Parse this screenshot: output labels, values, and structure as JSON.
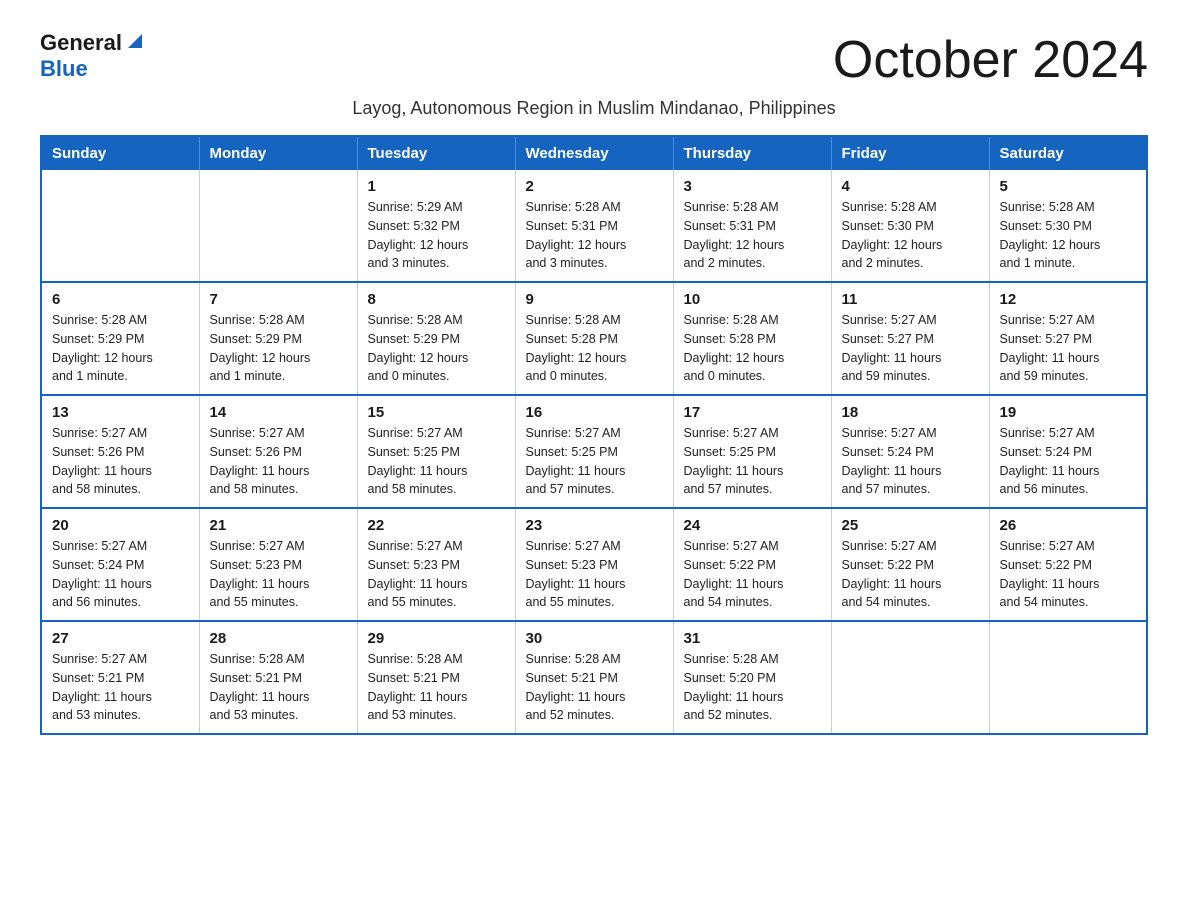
{
  "header": {
    "logo_general": "General",
    "logo_blue": "Blue",
    "month_title": "October 2024",
    "subtitle": "Layog, Autonomous Region in Muslim Mindanao, Philippines"
  },
  "weekdays": [
    "Sunday",
    "Monday",
    "Tuesday",
    "Wednesday",
    "Thursday",
    "Friday",
    "Saturday"
  ],
  "weeks": [
    [
      {
        "day": "",
        "info": ""
      },
      {
        "day": "",
        "info": ""
      },
      {
        "day": "1",
        "info": "Sunrise: 5:29 AM\nSunset: 5:32 PM\nDaylight: 12 hours\nand 3 minutes."
      },
      {
        "day": "2",
        "info": "Sunrise: 5:28 AM\nSunset: 5:31 PM\nDaylight: 12 hours\nand 3 minutes."
      },
      {
        "day": "3",
        "info": "Sunrise: 5:28 AM\nSunset: 5:31 PM\nDaylight: 12 hours\nand 2 minutes."
      },
      {
        "day": "4",
        "info": "Sunrise: 5:28 AM\nSunset: 5:30 PM\nDaylight: 12 hours\nand 2 minutes."
      },
      {
        "day": "5",
        "info": "Sunrise: 5:28 AM\nSunset: 5:30 PM\nDaylight: 12 hours\nand 1 minute."
      }
    ],
    [
      {
        "day": "6",
        "info": "Sunrise: 5:28 AM\nSunset: 5:29 PM\nDaylight: 12 hours\nand 1 minute."
      },
      {
        "day": "7",
        "info": "Sunrise: 5:28 AM\nSunset: 5:29 PM\nDaylight: 12 hours\nand 1 minute."
      },
      {
        "day": "8",
        "info": "Sunrise: 5:28 AM\nSunset: 5:29 PM\nDaylight: 12 hours\nand 0 minutes."
      },
      {
        "day": "9",
        "info": "Sunrise: 5:28 AM\nSunset: 5:28 PM\nDaylight: 12 hours\nand 0 minutes."
      },
      {
        "day": "10",
        "info": "Sunrise: 5:28 AM\nSunset: 5:28 PM\nDaylight: 12 hours\nand 0 minutes."
      },
      {
        "day": "11",
        "info": "Sunrise: 5:27 AM\nSunset: 5:27 PM\nDaylight: 11 hours\nand 59 minutes."
      },
      {
        "day": "12",
        "info": "Sunrise: 5:27 AM\nSunset: 5:27 PM\nDaylight: 11 hours\nand 59 minutes."
      }
    ],
    [
      {
        "day": "13",
        "info": "Sunrise: 5:27 AM\nSunset: 5:26 PM\nDaylight: 11 hours\nand 58 minutes."
      },
      {
        "day": "14",
        "info": "Sunrise: 5:27 AM\nSunset: 5:26 PM\nDaylight: 11 hours\nand 58 minutes."
      },
      {
        "day": "15",
        "info": "Sunrise: 5:27 AM\nSunset: 5:25 PM\nDaylight: 11 hours\nand 58 minutes."
      },
      {
        "day": "16",
        "info": "Sunrise: 5:27 AM\nSunset: 5:25 PM\nDaylight: 11 hours\nand 57 minutes."
      },
      {
        "day": "17",
        "info": "Sunrise: 5:27 AM\nSunset: 5:25 PM\nDaylight: 11 hours\nand 57 minutes."
      },
      {
        "day": "18",
        "info": "Sunrise: 5:27 AM\nSunset: 5:24 PM\nDaylight: 11 hours\nand 57 minutes."
      },
      {
        "day": "19",
        "info": "Sunrise: 5:27 AM\nSunset: 5:24 PM\nDaylight: 11 hours\nand 56 minutes."
      }
    ],
    [
      {
        "day": "20",
        "info": "Sunrise: 5:27 AM\nSunset: 5:24 PM\nDaylight: 11 hours\nand 56 minutes."
      },
      {
        "day": "21",
        "info": "Sunrise: 5:27 AM\nSunset: 5:23 PM\nDaylight: 11 hours\nand 55 minutes."
      },
      {
        "day": "22",
        "info": "Sunrise: 5:27 AM\nSunset: 5:23 PM\nDaylight: 11 hours\nand 55 minutes."
      },
      {
        "day": "23",
        "info": "Sunrise: 5:27 AM\nSunset: 5:23 PM\nDaylight: 11 hours\nand 55 minutes."
      },
      {
        "day": "24",
        "info": "Sunrise: 5:27 AM\nSunset: 5:22 PM\nDaylight: 11 hours\nand 54 minutes."
      },
      {
        "day": "25",
        "info": "Sunrise: 5:27 AM\nSunset: 5:22 PM\nDaylight: 11 hours\nand 54 minutes."
      },
      {
        "day": "26",
        "info": "Sunrise: 5:27 AM\nSunset: 5:22 PM\nDaylight: 11 hours\nand 54 minutes."
      }
    ],
    [
      {
        "day": "27",
        "info": "Sunrise: 5:27 AM\nSunset: 5:21 PM\nDaylight: 11 hours\nand 53 minutes."
      },
      {
        "day": "28",
        "info": "Sunrise: 5:28 AM\nSunset: 5:21 PM\nDaylight: 11 hours\nand 53 minutes."
      },
      {
        "day": "29",
        "info": "Sunrise: 5:28 AM\nSunset: 5:21 PM\nDaylight: 11 hours\nand 53 minutes."
      },
      {
        "day": "30",
        "info": "Sunrise: 5:28 AM\nSunset: 5:21 PM\nDaylight: 11 hours\nand 52 minutes."
      },
      {
        "day": "31",
        "info": "Sunrise: 5:28 AM\nSunset: 5:20 PM\nDaylight: 11 hours\nand 52 minutes."
      },
      {
        "day": "",
        "info": ""
      },
      {
        "day": "",
        "info": ""
      }
    ]
  ]
}
